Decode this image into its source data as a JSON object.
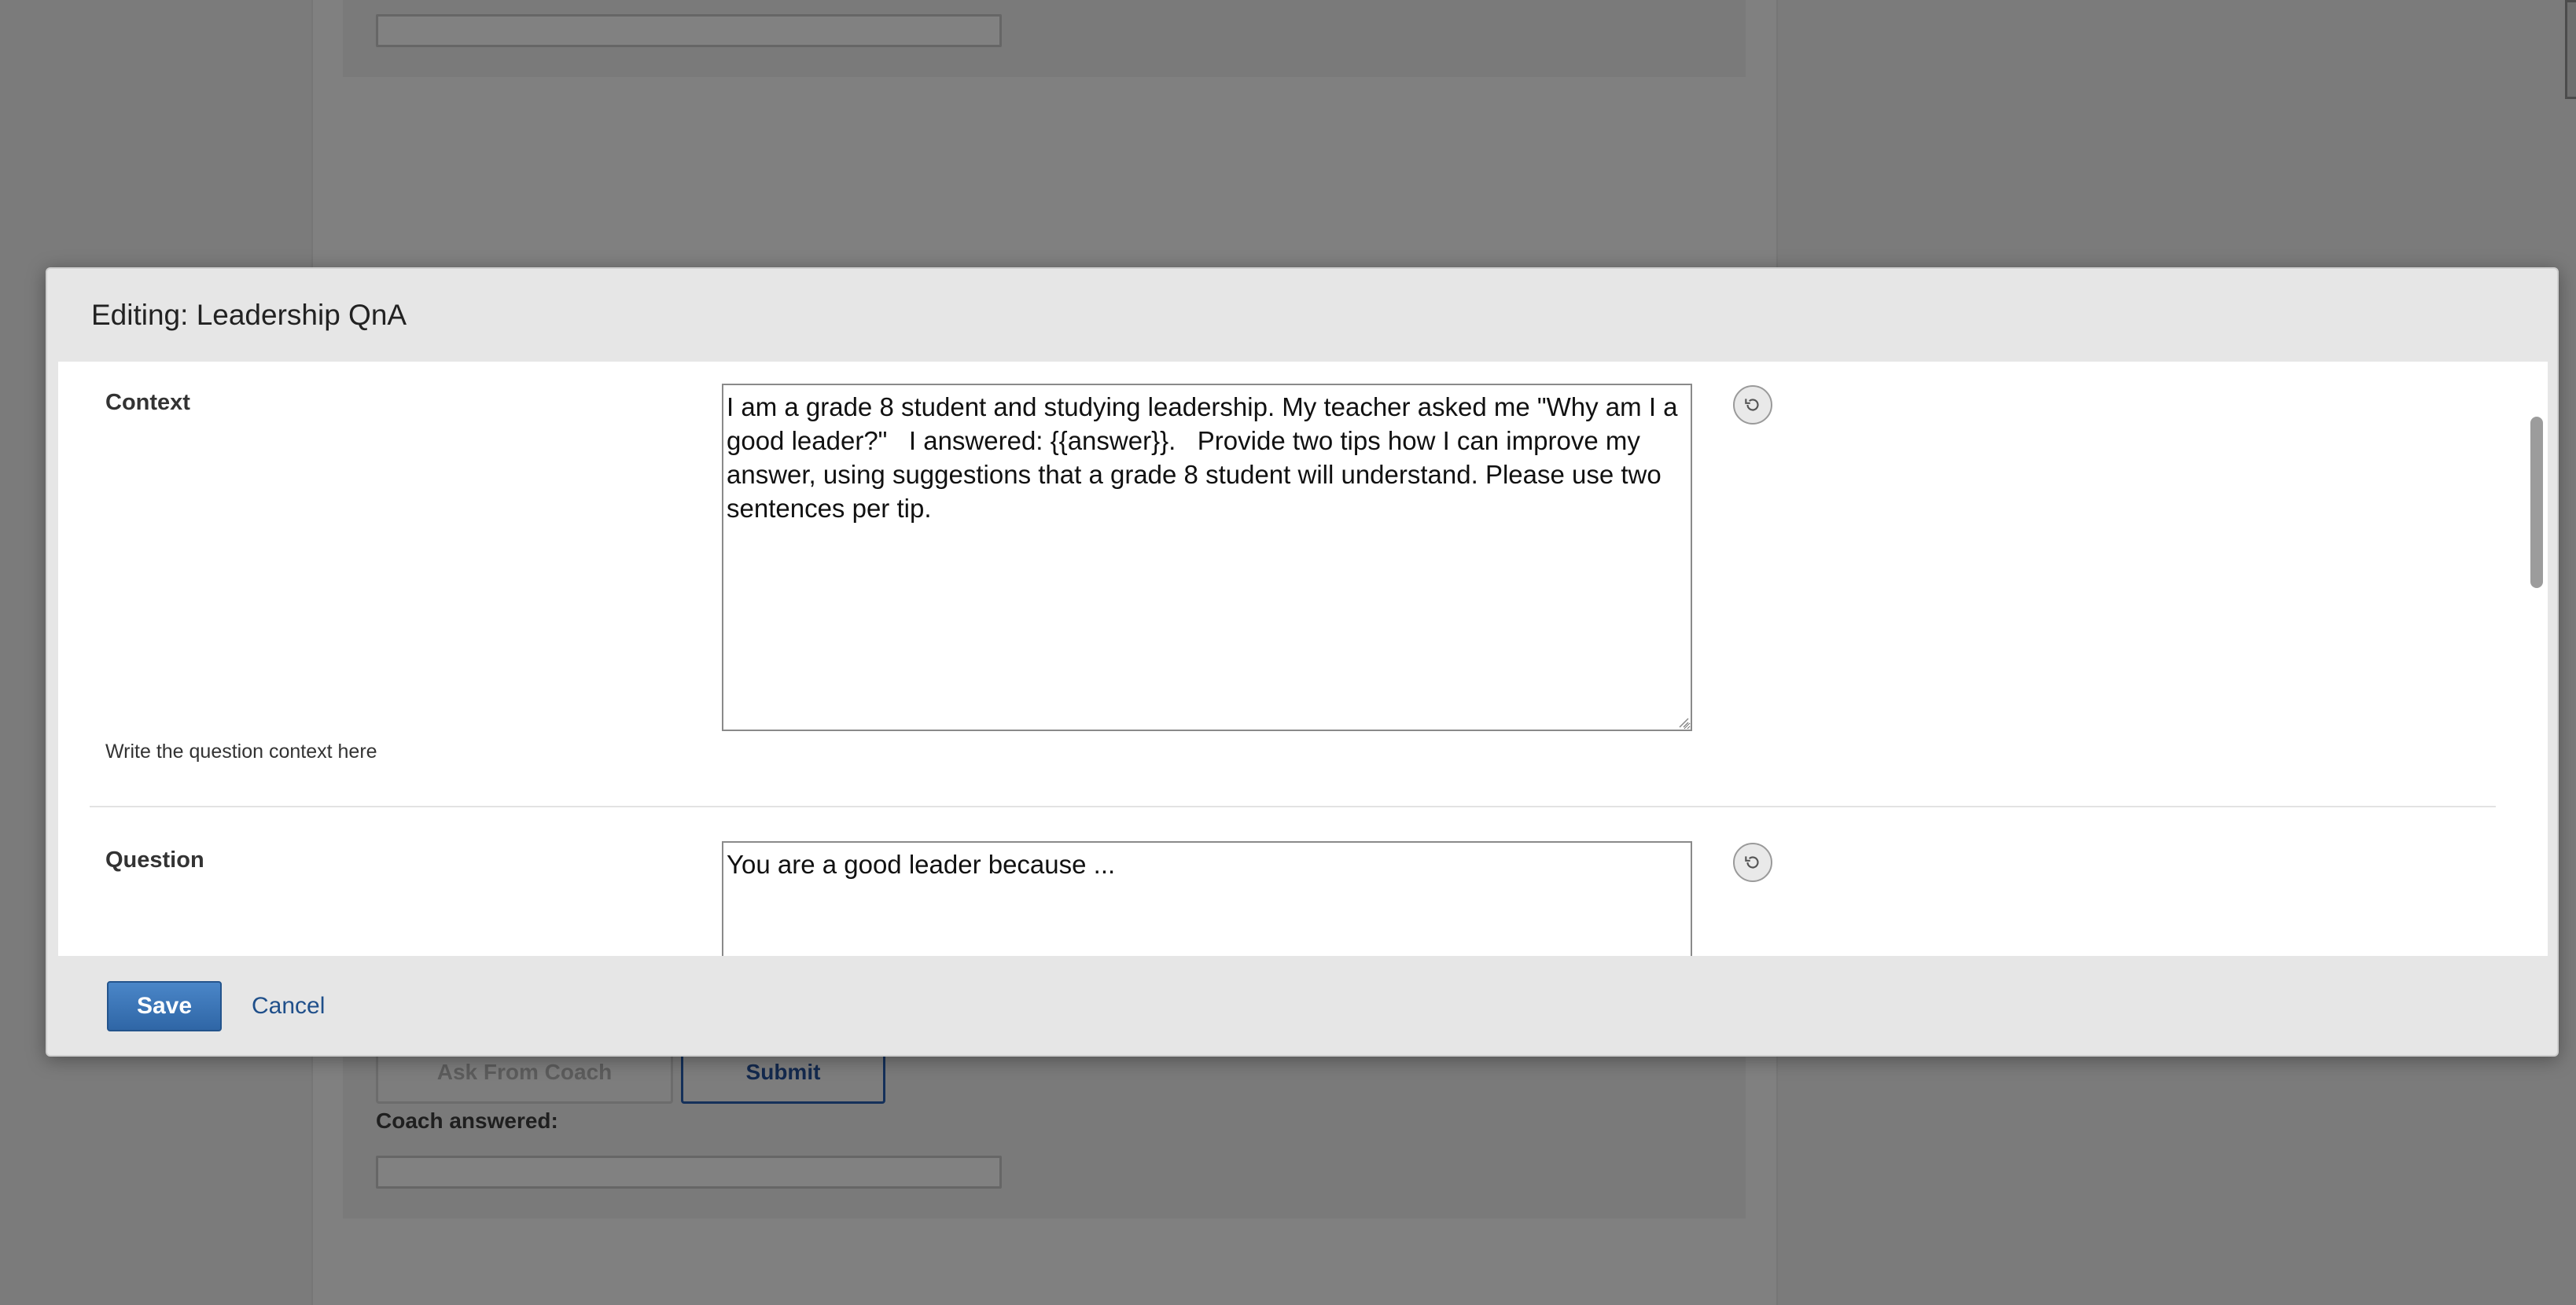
{
  "background": {
    "ask_button_label": "Ask From Coach",
    "submit_button_label": "Submit",
    "coach_answered_label": "Coach answered:"
  },
  "modal": {
    "title": "Editing: Leadership QnA",
    "fields": [
      {
        "label": "Context",
        "value": "I am a grade 8 student and studying leadership. My teacher asked me \"Why am I a good leader?\"   I answered: {{answer}}.   Provide two tips how I can improve my answer, using suggestions that a grade 8 student will understand. Please use two sentences per tip.",
        "help": "Write the question context here",
        "reset_icon": "reset-icon"
      },
      {
        "label": "Question",
        "value": "You are a good leader because ...",
        "reset_icon": "reset-icon"
      }
    ],
    "footer": {
      "save_label": "Save",
      "cancel_label": "Cancel"
    }
  },
  "colors": {
    "overlay": "#7b7b7b",
    "modal_bg": "#e6e6e6",
    "body_bg": "#ffffff",
    "primary_button": "#3b76b8",
    "link": "#1f4f8a"
  }
}
